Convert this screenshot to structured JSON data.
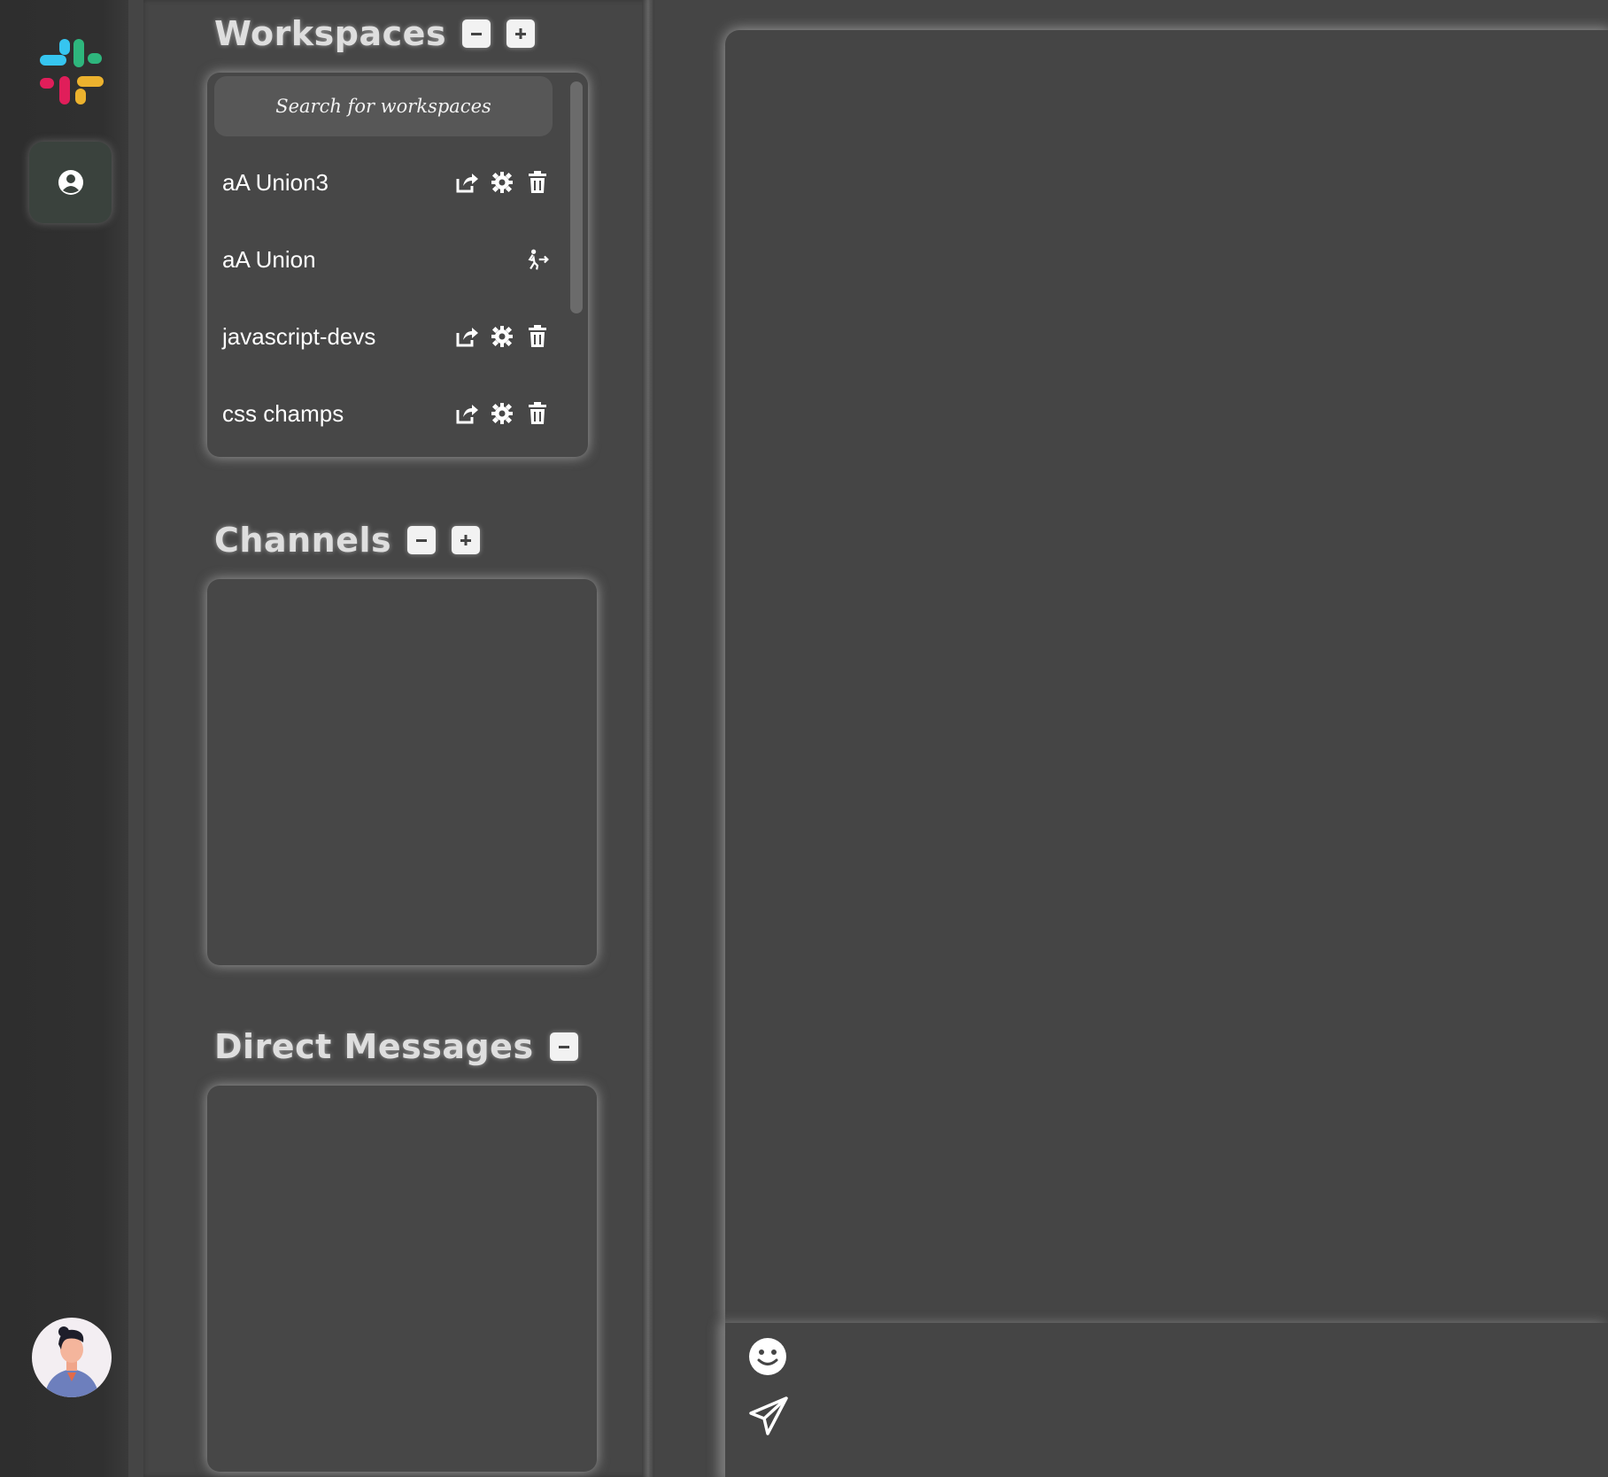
{
  "app": {
    "brand_colors": {
      "blue": "#36c5f0",
      "green": "#2eb67d",
      "red": "#e01e5a",
      "yellow": "#ecb22e"
    },
    "background": "#454545",
    "rail_background": "#303030"
  },
  "rail": {
    "logo_icon": "slack-logo-icon",
    "profile_icon": "user-circle-icon",
    "avatar": "user-avatar"
  },
  "workspaces": {
    "title": "Workspaces",
    "search_placeholder": "Search for workspaces",
    "items": [
      {
        "name": "aA Union3",
        "actions": [
          "share-icon",
          "gear-icon",
          "trash-icon"
        ]
      },
      {
        "name": "aA Union",
        "actions": [
          "leave-icon"
        ]
      },
      {
        "name": "javascript-devs",
        "actions": [
          "share-icon",
          "gear-icon",
          "trash-icon"
        ]
      },
      {
        "name": "css champs",
        "actions": [
          "share-icon",
          "gear-icon",
          "trash-icon"
        ]
      }
    ]
  },
  "channels": {
    "title": "Channels",
    "items": []
  },
  "direct_messages": {
    "title": "Direct Messages",
    "items": []
  },
  "composer": {
    "emoji_icon": "smiley-icon",
    "send_icon": "paper-plane-icon"
  }
}
